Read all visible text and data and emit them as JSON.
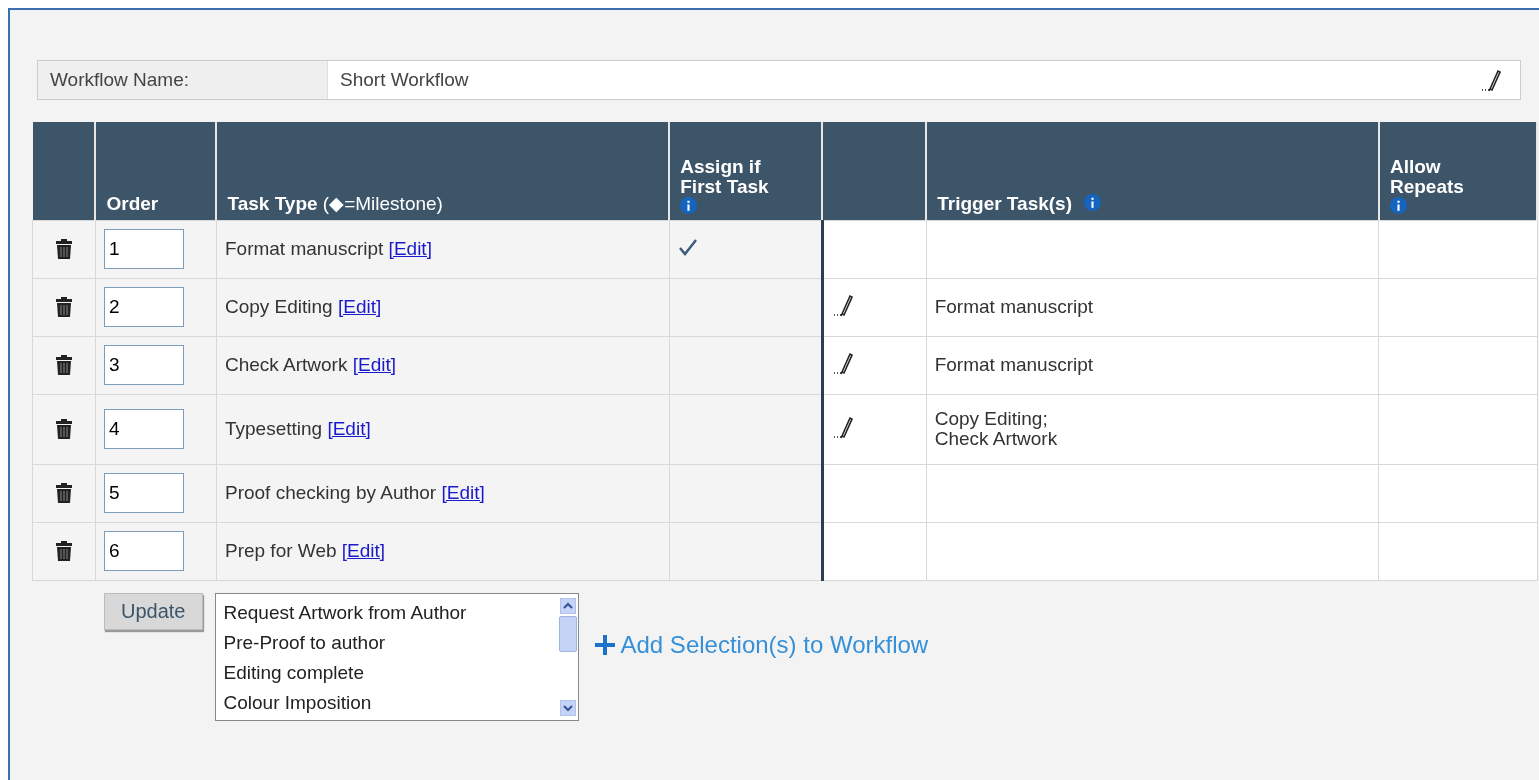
{
  "workflow_name": {
    "label": "Workflow Name:",
    "value": "Short Workflow"
  },
  "table": {
    "columns": [
      {
        "label": "Order",
        "info": false
      },
      {
        "label": "Task Type",
        "suffix": "(◆=Milestone)",
        "info": false
      },
      {
        "label": "Assign if First Task",
        "info": true
      },
      {
        "label": "Trigger Task(s)",
        "info": true
      },
      {
        "label": "Allow Repeats",
        "info": true
      }
    ],
    "rows": [
      {
        "order": "1",
        "task": "Format manuscript",
        "edit": "[Edit]",
        "assign": true,
        "trigger_edit": false,
        "triggers": []
      },
      {
        "order": "2",
        "task": "Copy Editing",
        "edit": "[Edit]",
        "assign": false,
        "trigger_edit": true,
        "triggers": [
          "Format manuscript"
        ]
      },
      {
        "order": "3",
        "task": "Check Artwork",
        "edit": "[Edit]",
        "assign": false,
        "trigger_edit": true,
        "triggers": [
          "Format manuscript"
        ]
      },
      {
        "order": "4",
        "task": "Typesetting",
        "edit": "[Edit]",
        "assign": false,
        "trigger_edit": true,
        "triggers": [
          "Copy Editing;",
          "Check Artwork"
        ]
      },
      {
        "order": "5",
        "task": "Proof checking by Author",
        "edit": "[Edit]",
        "assign": false,
        "trigger_edit": false,
        "triggers": []
      },
      {
        "order": "6",
        "task": "Prep for Web",
        "edit": "[Edit]",
        "assign": false,
        "trigger_edit": false,
        "triggers": []
      }
    ]
  },
  "update_button": "Update",
  "task_list": [
    {
      "label": "Request Artwork from Author",
      "selected": false
    },
    {
      "label": "Pre-Proof to author",
      "selected": false
    },
    {
      "label": "Editing complete",
      "selected": false
    },
    {
      "label": "Colour Imposition",
      "selected": false
    }
  ],
  "add_link": "Add Selection(s) to Workflow"
}
